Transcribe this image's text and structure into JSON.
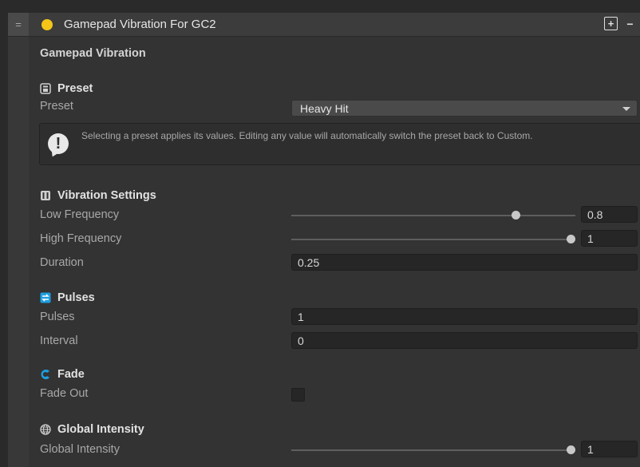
{
  "header": {
    "drag_glyph": "=",
    "title": "Gamepad Vibration For GC2",
    "add_glyph": "+",
    "remove_glyph": "−",
    "dot_color": "#f5c518"
  },
  "component_title": "Gamepad Vibration",
  "preset_section": {
    "title": "Preset",
    "preset_label": "Preset",
    "preset_value": "Heavy Hit",
    "info_glyph": "!",
    "info_text": "Selecting a preset applies its values. Editing any value will automatically switch the preset back to Custom."
  },
  "vibration_section": {
    "title": "Vibration Settings",
    "low_frequency_label": "Low Frequency",
    "low_frequency_value": "0.8",
    "low_frequency_fraction": 0.8,
    "high_frequency_label": "High Frequency",
    "high_frequency_value": "1",
    "high_frequency_fraction": 1,
    "duration_label": "Duration",
    "duration_value": "0.25"
  },
  "pulses_section": {
    "title": "Pulses",
    "pulses_label": "Pulses",
    "pulses_value": "1",
    "interval_label": "Interval",
    "interval_value": "0",
    "icon_color": "#1e9fe0"
  },
  "fade_section": {
    "title": "Fade",
    "fade_out_label": "Fade Out",
    "fade_out_checked": false,
    "icon_color": "#1e9fe0"
  },
  "intensity_section": {
    "title": "Global Intensity",
    "label": "Global Intensity",
    "value": "1",
    "fraction": 1
  }
}
